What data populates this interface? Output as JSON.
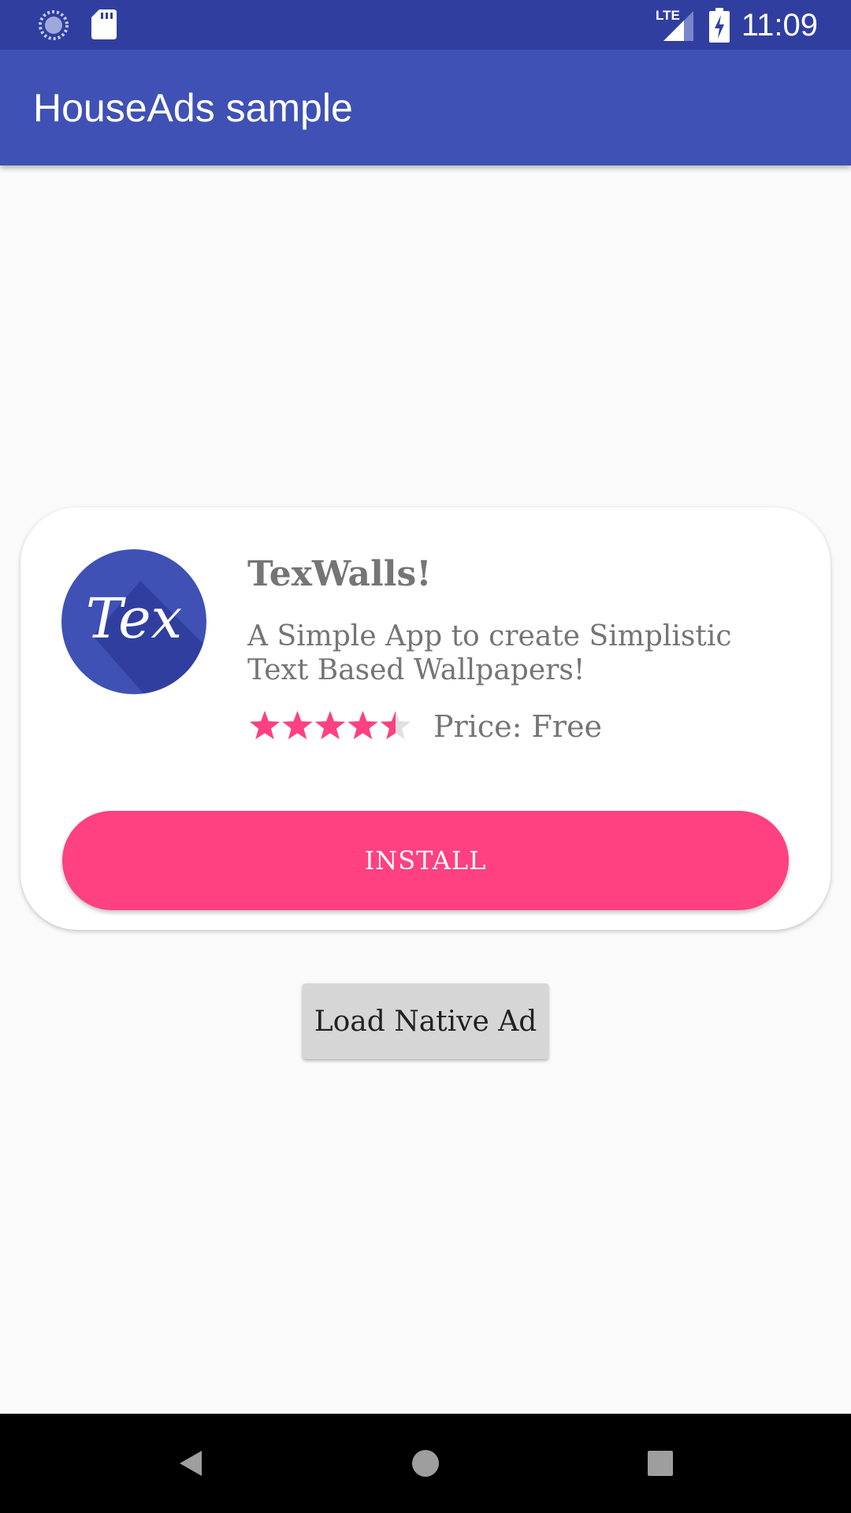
{
  "status_bar": {
    "time": "11:09",
    "network_label": "LTE",
    "icons": [
      "sync-icon",
      "sd-card-icon",
      "lte-signal-icon",
      "battery-charging-icon"
    ]
  },
  "app_bar": {
    "title": "HouseAds sample"
  },
  "ad_card": {
    "app_icon_text": "Tex",
    "app_name": "TexWalls!",
    "description": "A Simple App to create Simplistic Text Based Wallpapers!",
    "rating": 4.5,
    "rating_max": 5,
    "price": "Price: Free",
    "install_label": "INSTALL"
  },
  "load_button_label": "Load Native Ad",
  "nav_bar": {
    "icons": [
      "back-icon",
      "home-icon",
      "recents-icon"
    ]
  },
  "colors": {
    "status_bar": "#303f9f",
    "app_bar": "#3f51b5",
    "accent": "#ff4081",
    "star_filled": "#ff4081",
    "star_empty": "#e0e0e0",
    "text_secondary": "#757575"
  }
}
